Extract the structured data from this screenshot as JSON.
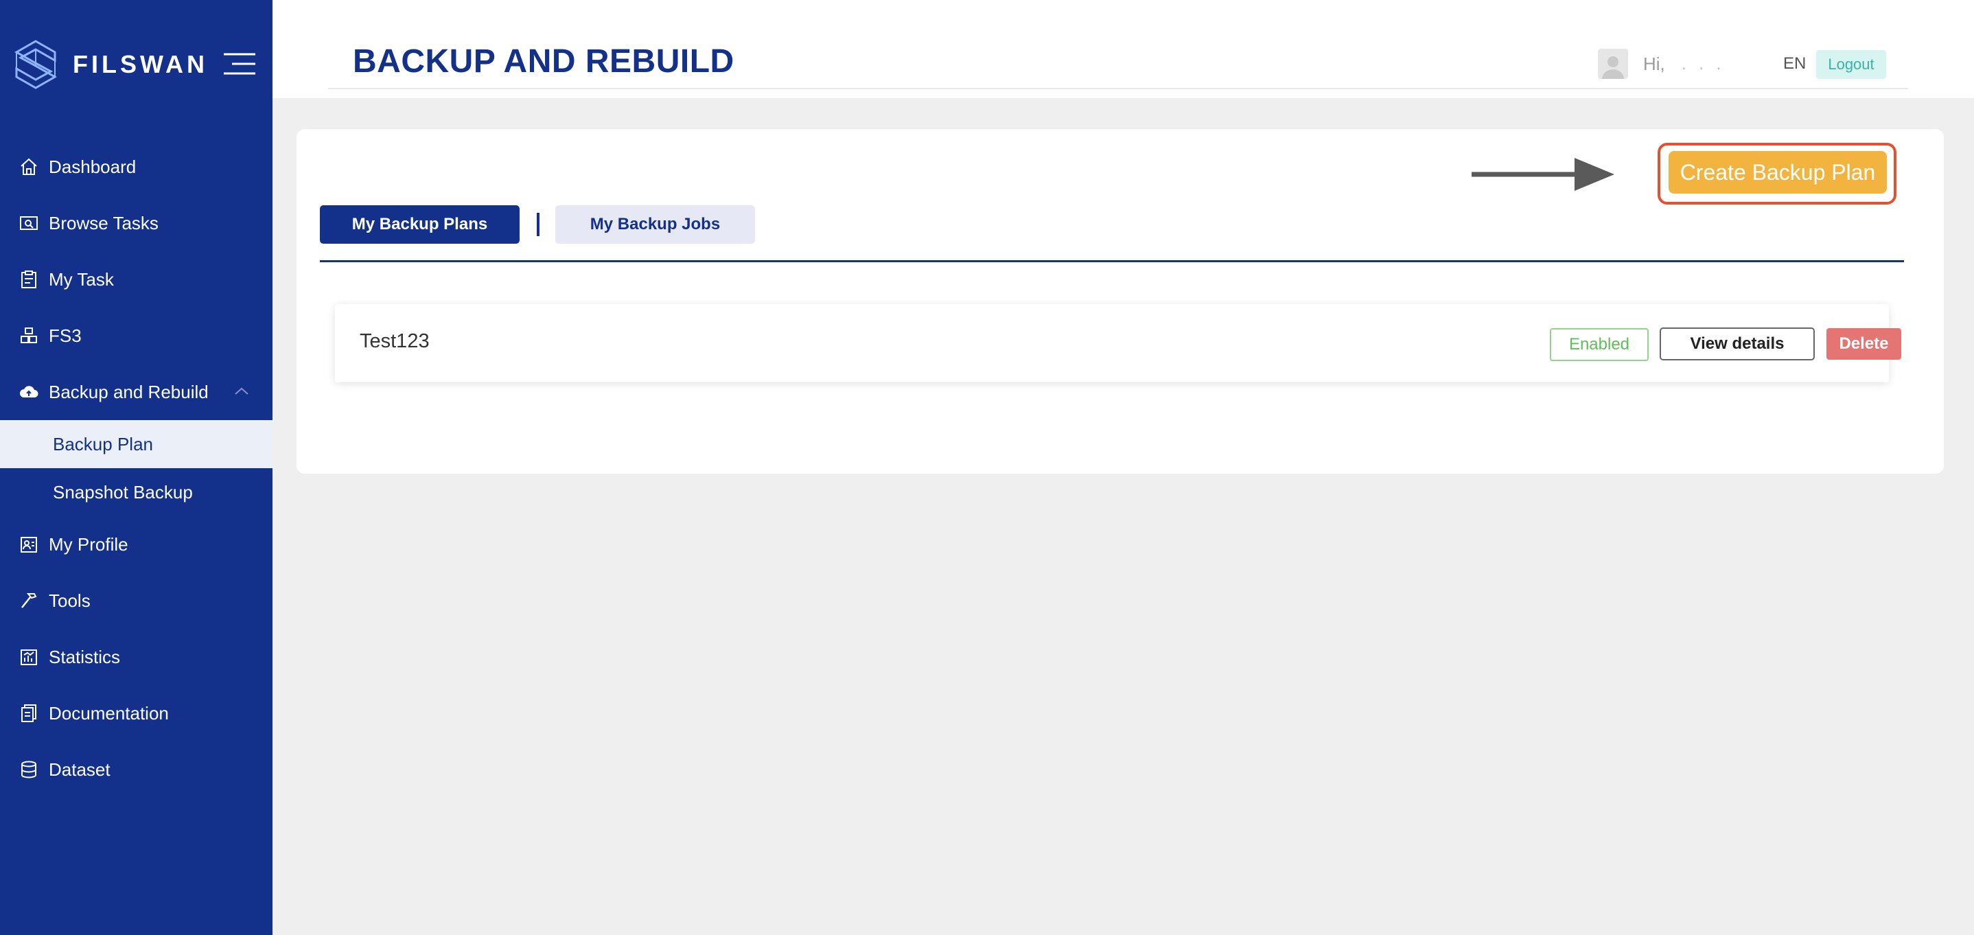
{
  "brand": {
    "name": "FILSWAN"
  },
  "sidebar": {
    "items": [
      {
        "label": "Dashboard",
        "icon": "home-icon"
      },
      {
        "label": "Browse Tasks",
        "icon": "browse-icon"
      },
      {
        "label": "My Task",
        "icon": "clipboard-icon"
      },
      {
        "label": "FS3",
        "icon": "boxes-icon"
      },
      {
        "label": "Backup and Rebuild",
        "icon": "cloud-upload-icon",
        "expanded": true,
        "children": [
          {
            "label": "Backup Plan",
            "active": true
          },
          {
            "label": "Snapshot Backup",
            "active": false
          }
        ]
      },
      {
        "label": "My Profile",
        "icon": "profile-icon"
      },
      {
        "label": "Tools",
        "icon": "hammer-icon"
      },
      {
        "label": "Statistics",
        "icon": "chart-icon"
      },
      {
        "label": "Documentation",
        "icon": "document-icon"
      },
      {
        "label": "Dataset",
        "icon": "database-icon"
      }
    ]
  },
  "header": {
    "title": "BACKUP AND REBUILD",
    "greeting": "Hi,",
    "username_masked": ". . .",
    "language": "EN",
    "logout_label": "Logout"
  },
  "main": {
    "create_button_label": "Create Backup Plan",
    "tabs": [
      {
        "label": "My Backup Plans",
        "active": true
      },
      {
        "label": "My Backup Jobs",
        "active": false
      }
    ],
    "plans": [
      {
        "name": "Test123",
        "status": "Enabled",
        "view_label": "View details",
        "delete_label": "Delete"
      }
    ]
  },
  "colors": {
    "primary": "#13318a",
    "accent": "#f2b43f",
    "highlight": "#e3522e",
    "enabled": "#5fbf57",
    "danger": "#e57573",
    "logout_bg": "#d8f4f1"
  }
}
